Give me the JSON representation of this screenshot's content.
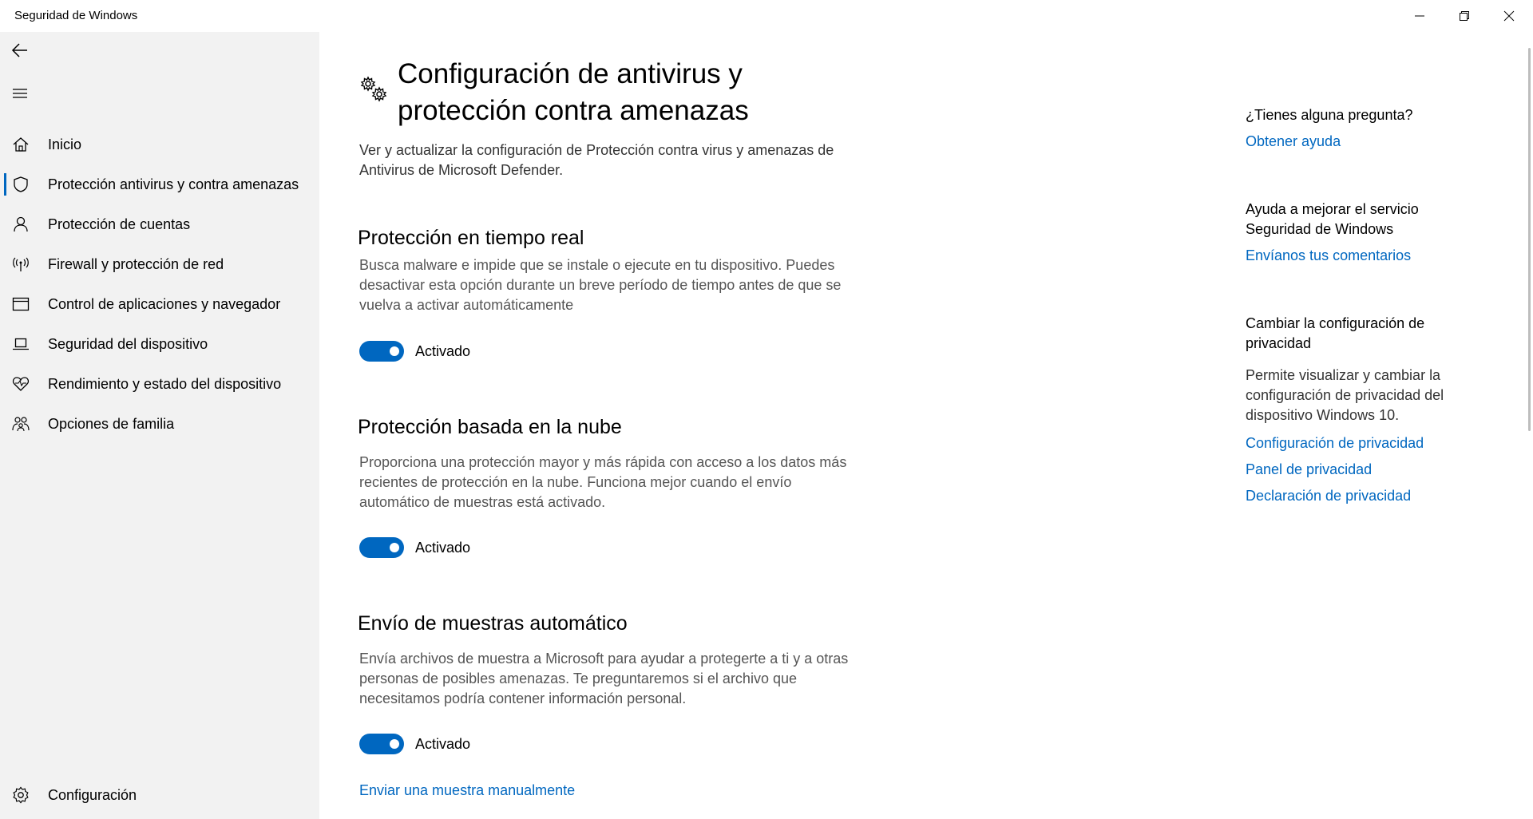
{
  "window": {
    "title": "Seguridad de Windows"
  },
  "sidebar": {
    "items": [
      {
        "label": "Inicio",
        "icon": "home-icon"
      },
      {
        "label": "Protección antivirus y contra amenazas",
        "icon": "shield-icon",
        "selected": true
      },
      {
        "label": "Protección de cuentas",
        "icon": "person-icon"
      },
      {
        "label": "Firewall y protección de red",
        "icon": "wireless-icon"
      },
      {
        "label": "Control de aplicaciones y navegador",
        "icon": "browser-window-icon"
      },
      {
        "label": "Seguridad del dispositivo",
        "icon": "laptop-icon"
      },
      {
        "label": "Rendimiento y estado del dispositivo",
        "icon": "heart-pulse-icon"
      },
      {
        "label": "Opciones de familia",
        "icon": "family-icon"
      }
    ],
    "settings_label": "Configuración",
    "accent_color": "#0067c0"
  },
  "main": {
    "title": "Configuración de antivirus y protección contra amenazas",
    "description": "Ver y actualizar la configuración de Protección contra virus y amenazas de Antivirus de Microsoft Defender.",
    "sections": [
      {
        "title": "Protección en tiempo real",
        "description": "Busca malware e impide que se instale o ejecute en tu dispositivo. Puedes desactivar esta opción durante un breve período de tiempo antes de que se vuelva a activar automáticamente",
        "toggle_state": "Activado"
      },
      {
        "title": "Protección basada en la nube",
        "description": "Proporciona una protección mayor y más rápida con acceso a los datos más recientes de protección en la nube. Funciona mejor cuando el envío automático de muestras está activado.",
        "toggle_state": "Activado"
      },
      {
        "title": "Envío de muestras automático",
        "description": "Envía archivos de muestra a Microsoft para ayudar a protegerte a ti y a otras personas de posibles amenazas. Te preguntaremos si el archivo que necesitamos podría contener información personal.",
        "toggle_state": "Activado"
      }
    ],
    "manual_sample_link": "Enviar una muestra manualmente"
  },
  "right_panel": {
    "question_heading": "¿Tienes alguna pregunta?",
    "help_link": "Obtener ayuda",
    "improve_heading": "Ayuda a mejorar el servicio Seguridad de Windows",
    "feedback_link": "Envíanos tus comentarios",
    "privacy_heading": "Cambiar la configuración de privacidad",
    "privacy_text": "Permite visualizar y cambiar la configuración de privacidad del dispositivo Windows 10.",
    "privacy_links": [
      "Configuración de privacidad",
      "Panel de privacidad",
      "Declaración de privacidad"
    ]
  }
}
